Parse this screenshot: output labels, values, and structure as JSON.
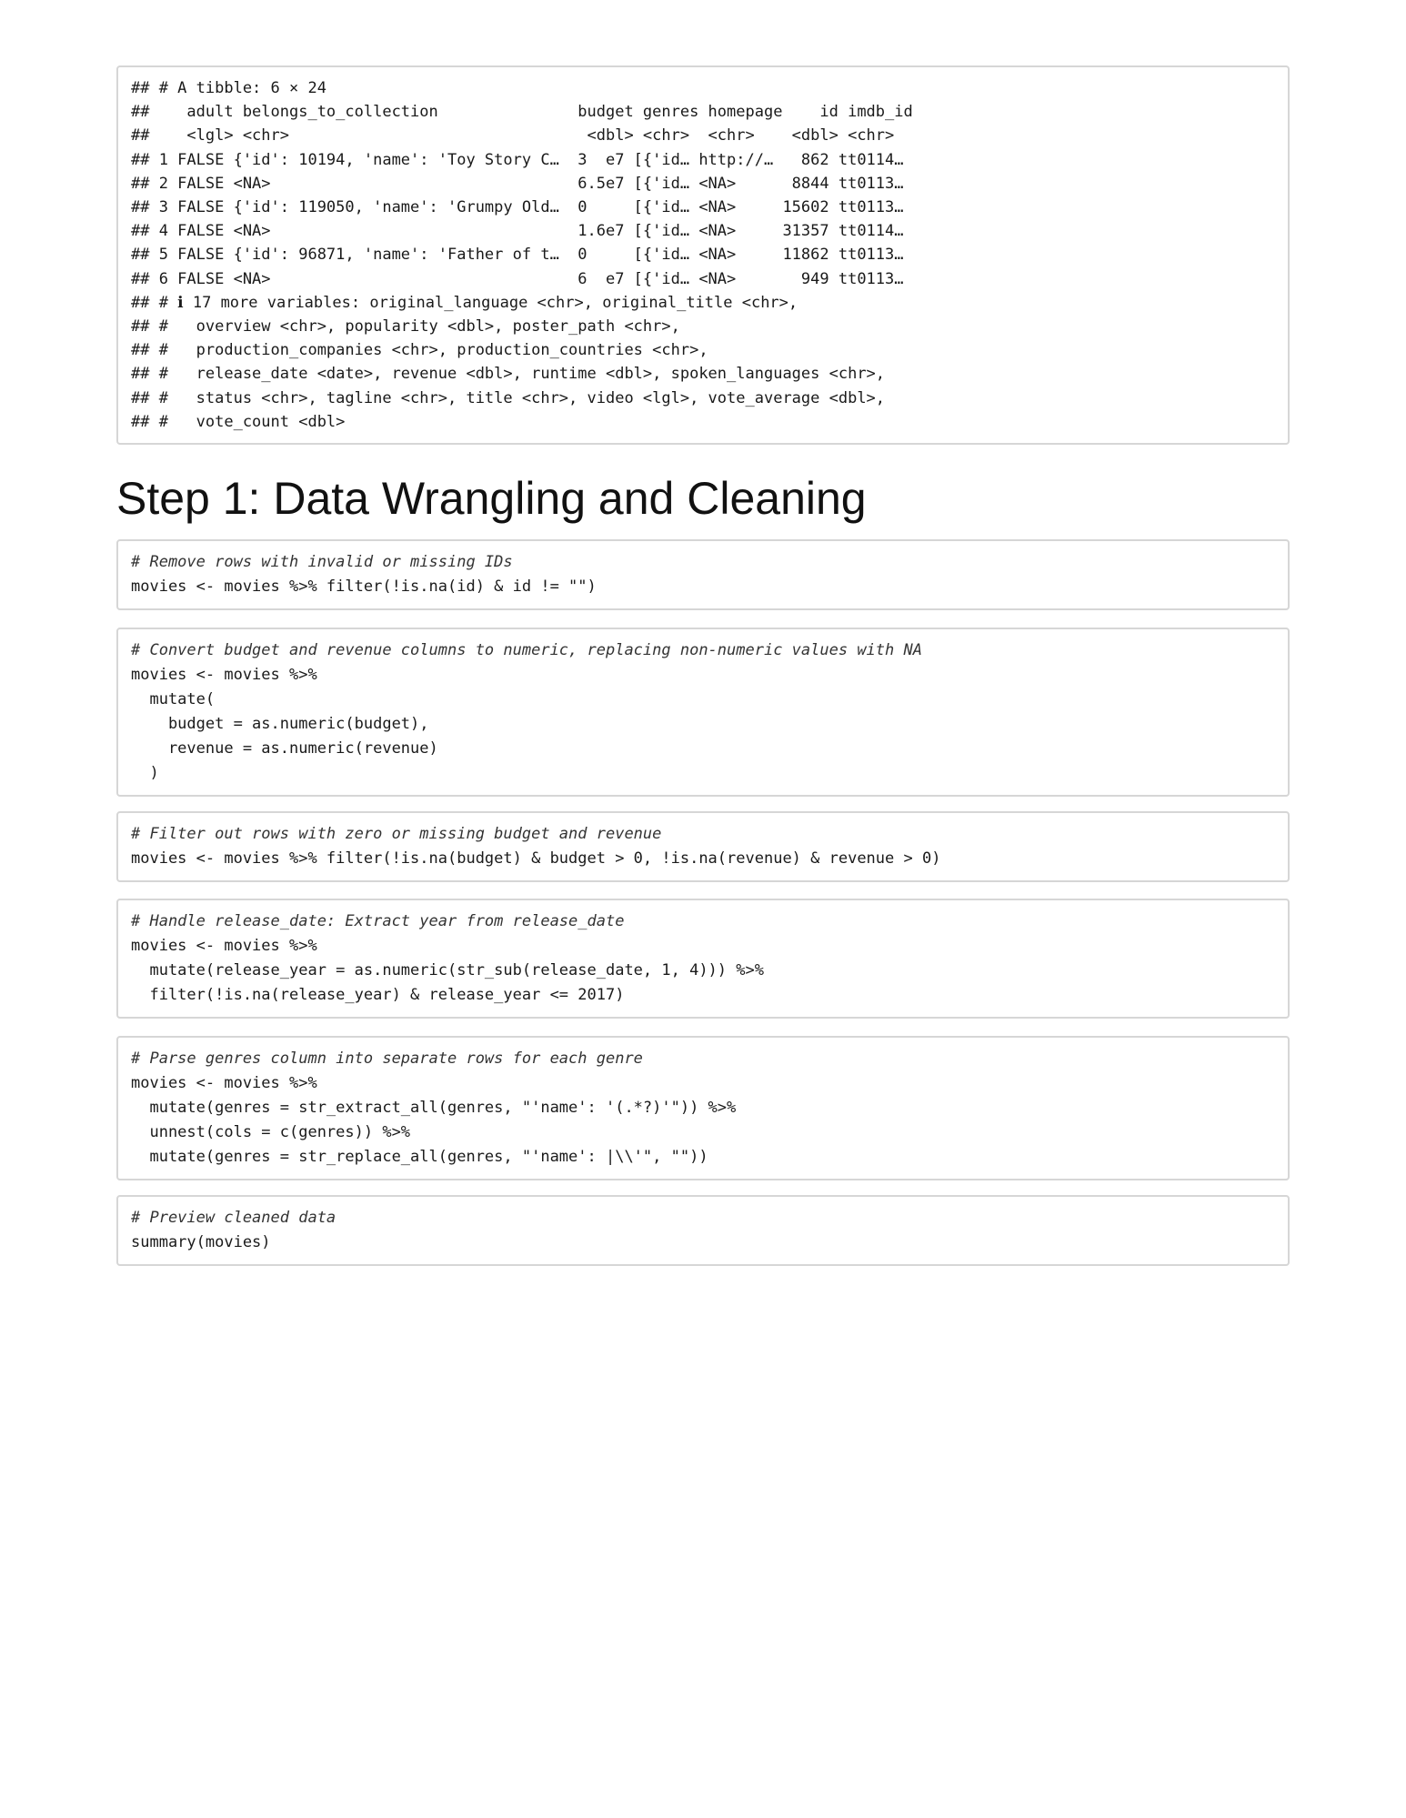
{
  "output_block": {
    "lines": [
      "## # A tibble: 6 × 24",
      "##    adult belongs_to_collection               budget genres homepage    id imdb_id",
      "##    <lgl> <chr>                                <dbl> <chr>  <chr>    <dbl> <chr>",
      "## 1 FALSE {'id': 10194, 'name': 'Toy Story C…  3  e7 [{'id… http://…   862 tt0114…",
      "## 2 FALSE <NA>                                 6.5e7 [{'id… <NA>      8844 tt0113…",
      "## 3 FALSE {'id': 119050, 'name': 'Grumpy Old…  0     [{'id… <NA>     15602 tt0113…",
      "## 4 FALSE <NA>                                 1.6e7 [{'id… <NA>     31357 tt0114…",
      "## 5 FALSE {'id': 96871, 'name': 'Father of t…  0     [{'id… <NA>     11862 tt0113…",
      "## 6 FALSE <NA>                                 6  e7 [{'id… <NA>       949 tt0113…",
      "## # ℹ 17 more variables: original_language <chr>, original_title <chr>,",
      "## #   overview <chr>, popularity <dbl>, poster_path <chr>,",
      "## #   production_companies <chr>, production_countries <chr>,",
      "## #   release_date <date>, revenue <dbl>, runtime <dbl>, spoken_languages <chr>,",
      "## #   status <chr>, tagline <chr>, title <chr>, video <lgl>, vote_average <dbl>,",
      "## #   vote_count <dbl>"
    ]
  },
  "section_heading": "Step 1: Data Wrangling and Cleaning",
  "code_blocks": [
    {
      "comment": "# Remove rows with invalid or missing IDs",
      "code": "movies <- movies %>% filter(!is.na(id) & id != \"\")"
    },
    {
      "comment": "# Convert budget and revenue columns to numeric, replacing non-numeric values with NA",
      "code": "movies <- movies %>%\n  mutate(\n    budget = as.numeric(budget),\n    revenue = as.numeric(revenue)\n  )"
    },
    {
      "comment": "# Filter out rows with zero or missing budget and revenue",
      "code": "movies <- movies %>% filter(!is.na(budget) & budget > 0, !is.na(revenue) & revenue > 0)"
    },
    {
      "comment": "# Handle release_date: Extract year from release_date",
      "code": "movies <- movies %>%\n  mutate(release_year = as.numeric(str_sub(release_date, 1, 4))) %>%\n  filter(!is.na(release_year) & release_year <= 2017)"
    },
    {
      "comment": "# Parse genres column into separate rows for each genre",
      "code": "movies <- movies %>%\n  mutate(genres = str_extract_all(genres, \"'name': '(.*?)'\")) %>%\n  unnest(cols = c(genres)) %>%\n  mutate(genres = str_replace_all(genres, \"'name': |\\\\'\", \"\"))"
    },
    {
      "comment": "# Preview cleaned data",
      "code": "summary(movies)"
    }
  ]
}
